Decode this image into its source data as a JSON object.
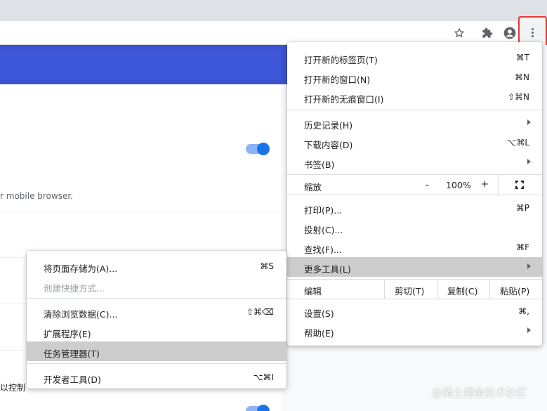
{
  "colors": {
    "accent": "#3f58d9",
    "highlight": "#cdcdcd",
    "toggle": "#1a73e8",
    "callout": "#e53935"
  },
  "toolbar": {
    "icons": [
      "star-icon",
      "extensions-icon",
      "profile-icon",
      "more-icon"
    ]
  },
  "background": {
    "snippet_text": "r mobile browser.",
    "snippet_text_2": "以控制"
  },
  "main_menu": {
    "new_tab": {
      "label": "打开新的标签页(T)",
      "shortcut": "⌘T"
    },
    "new_window": {
      "label": "打开新的窗口(N)",
      "shortcut": "⌘N"
    },
    "new_incognito": {
      "label": "打开新的无痕窗口(I)",
      "shortcut": "⇧⌘N"
    },
    "history": {
      "label": "历史记录(H)"
    },
    "downloads": {
      "label": "下载内容(D)",
      "shortcut": "⌥⌘L"
    },
    "bookmarks": {
      "label": "书签(B)"
    },
    "zoom": {
      "label": "缩放",
      "minus": "–",
      "value": "100%",
      "plus": "+"
    },
    "print": {
      "label": "打印(P)...",
      "shortcut": "⌘P"
    },
    "cast": {
      "label": "投射(C)..."
    },
    "find": {
      "label": "查找(F)...",
      "shortcut": "⌘F"
    },
    "more_tools": {
      "label": "更多工具(L)"
    },
    "edit": {
      "label": "编辑",
      "cut": "剪切(T)",
      "copy": "复制(C)",
      "paste": "粘贴(P)"
    },
    "settings": {
      "label": "设置(S)",
      "shortcut": "⌘,"
    },
    "help": {
      "label": "帮助(E)"
    }
  },
  "sub_menu": {
    "save_page": {
      "label": "将页面存储为(A)...",
      "shortcut": "⌘S"
    },
    "create_shortcut": {
      "label": "创建快捷方式..."
    },
    "clear_data": {
      "label": "清除浏览数据(C)...",
      "shortcut": "⇧⌘⌫"
    },
    "extensions": {
      "label": "扩展程序(E)"
    },
    "task_manager": {
      "label": "任务管理器(T)"
    },
    "dev_tools": {
      "label": "开发者工具(D)",
      "shortcut": "⌥⌘I"
    }
  },
  "watermark": "@稀土掘金技术社区"
}
